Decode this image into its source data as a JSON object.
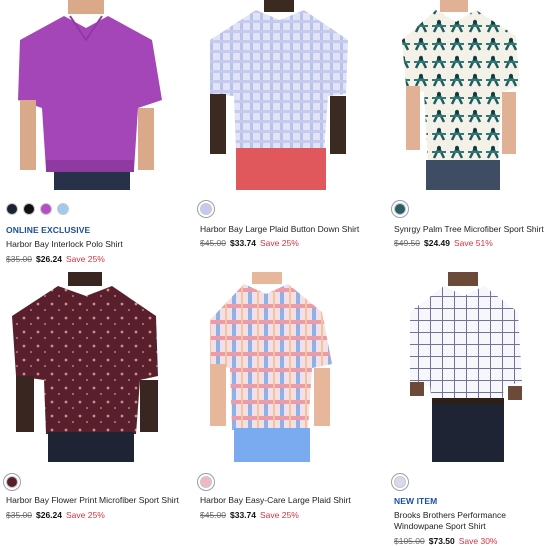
{
  "products": [
    {
      "flag": "ONLINE EXCLUSIVE",
      "name": "Harbor Bay Interlock Polo Shirt",
      "was": "$35.00",
      "now": "$26.24",
      "save": "Save 25%",
      "swatches": [
        "#1d2233",
        "#111111",
        "#b34fc2",
        "#9ccbee"
      ]
    },
    {
      "flag": "",
      "name": "Harbor Bay Large Plaid Button Down Shirt",
      "was": "$45.00",
      "now": "$33.74",
      "save": "Save 25%",
      "swatches": [
        "#c7c9ef"
      ]
    },
    {
      "flag": "",
      "name": "Synrgy Palm Tree Microfiber Sport Shirt",
      "was": "$49.50",
      "now": "$24.49",
      "save": "Save 51%",
      "swatches": [
        "#2a5f66"
      ]
    },
    {
      "flag": "",
      "name": "Harbor Bay Flower Print Microfiber Sport Shirt",
      "was": "$35.00",
      "now": "$26.24",
      "save": "Save 25%",
      "swatches": [
        "#5a1f2c"
      ]
    },
    {
      "flag": "",
      "name": "Harbor Bay Easy-Care Large Plaid Shirt",
      "was": "$45.00",
      "now": "$33.74",
      "save": "Save 25%",
      "swatches": [
        "#f1b7c3"
      ]
    },
    {
      "flag": "NEW ITEM",
      "name": "Brooks Brothers Performance Windowpane Sport Shirt",
      "was": "$105.00",
      "now": "$73.50",
      "save": "Save 30%",
      "swatches": [
        "#d9d9ee"
      ]
    }
  ],
  "colors": {
    "flag": "#1a4f9c",
    "save": "#d6343f",
    "strike": "#6b6b6b"
  }
}
